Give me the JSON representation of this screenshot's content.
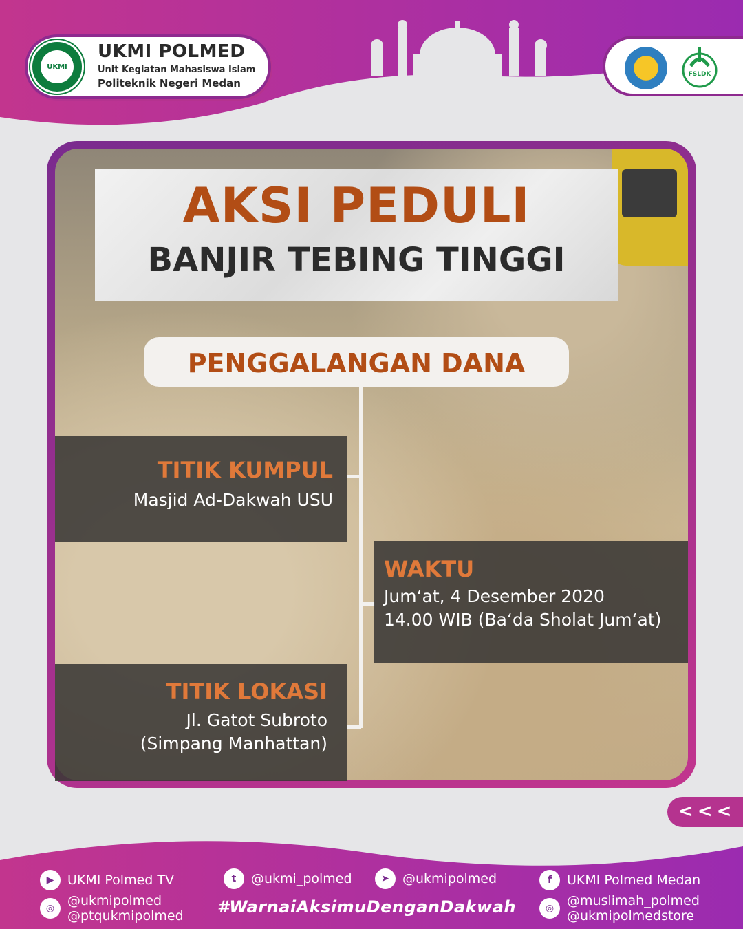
{
  "header": {
    "org_name": "UKMI POLMED",
    "org_line1": "Unit Kegiatan Mahasiswa Islam",
    "org_line2": "Politeknik Negeri Medan",
    "logo_text": "UKMI",
    "partner_logo_text": "FSLDK"
  },
  "title": {
    "line1": "AKSI PEDULI",
    "line2": "BANJIR TEBING TINGGI"
  },
  "subtitle": "PENGGALANGAN DANA",
  "info": {
    "kumpul": {
      "heading": "TITIK KUMPUL",
      "text": "Masjid Ad-Dakwah USU"
    },
    "waktu": {
      "heading": "WAKTU",
      "line1": "Jum‘at, 4 Desember 2020",
      "line2": "14.00 WIB (Ba‘da Sholat Jum‘at)"
    },
    "lokasi": {
      "heading": "TITIK LOKASI",
      "line1": "Jl. Gatot Subroto",
      "line2": "(Simpang Manhattan)"
    }
  },
  "nav": {
    "arrows": "<<<"
  },
  "footer": {
    "youtube": "UKMI Polmed TV",
    "twitter": "@ukmi_polmed",
    "telegram": "@ukmipolmed",
    "facebook": "UKMI Polmed Medan",
    "instagram_left_1": "@ukmipolmed",
    "instagram_left_2": "@ptqukmipolmed",
    "hashtag": "#WarnaiAksimuDenganDakwah",
    "instagram_right_1": "@muslimah_polmed",
    "instagram_right_2": "@ukmipolmedstore"
  },
  "colors": {
    "brand_purple": "#8e2a8f",
    "brand_magenta": "#c2358e",
    "accent_orange": "#b24d15",
    "heading_orange": "#e0793a"
  }
}
